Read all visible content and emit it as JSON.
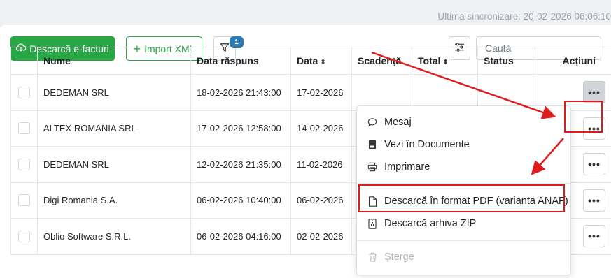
{
  "sync_text": "Ultima sincronizare: 20-02-2026 06:06:10",
  "toolbar": {
    "download_label": "Descarcă e-facturi",
    "import_label": "Import XML",
    "filter_badge": "1",
    "search_placeholder": "Caută"
  },
  "table": {
    "headers": {
      "name": "Nume",
      "response_date": "Data răspuns",
      "date": "Data",
      "due": "Scadență",
      "total": "Total",
      "status": "Status",
      "actions": "Acțiuni"
    },
    "rows": [
      {
        "name": "DEDEMAN SRL",
        "response_date": "18-02-2026 21:43:00",
        "date": "17-02-2026"
      },
      {
        "name": "ALTEX ROMANIA SRL",
        "response_date": "17-02-2026 12:58:00",
        "date": "14-02-2026"
      },
      {
        "name": "DEDEMAN SRL",
        "response_date": "12-02-2026 21:35:00",
        "date": "11-02-2026"
      },
      {
        "name": "Digi Romania S.A.",
        "response_date": "06-02-2026 10:40:00",
        "date": "06-02-2026"
      },
      {
        "name": "Oblio Software S.R.L.",
        "response_date": "06-02-2026 04:16:00",
        "date": "02-02-2026"
      }
    ]
  },
  "menu": {
    "message": "Mesaj",
    "view_docs": "Vezi în Documente",
    "print": "Imprimare",
    "download_pdf": "Descarcă în format PDF (varianta ANAF)",
    "download_zip": "Descarcă arhiva ZIP",
    "delete": "Șterge"
  },
  "colors": {
    "primary_green": "#28a745",
    "badge_blue": "#2b7ab8",
    "annotation_red": "#e01b1b"
  }
}
